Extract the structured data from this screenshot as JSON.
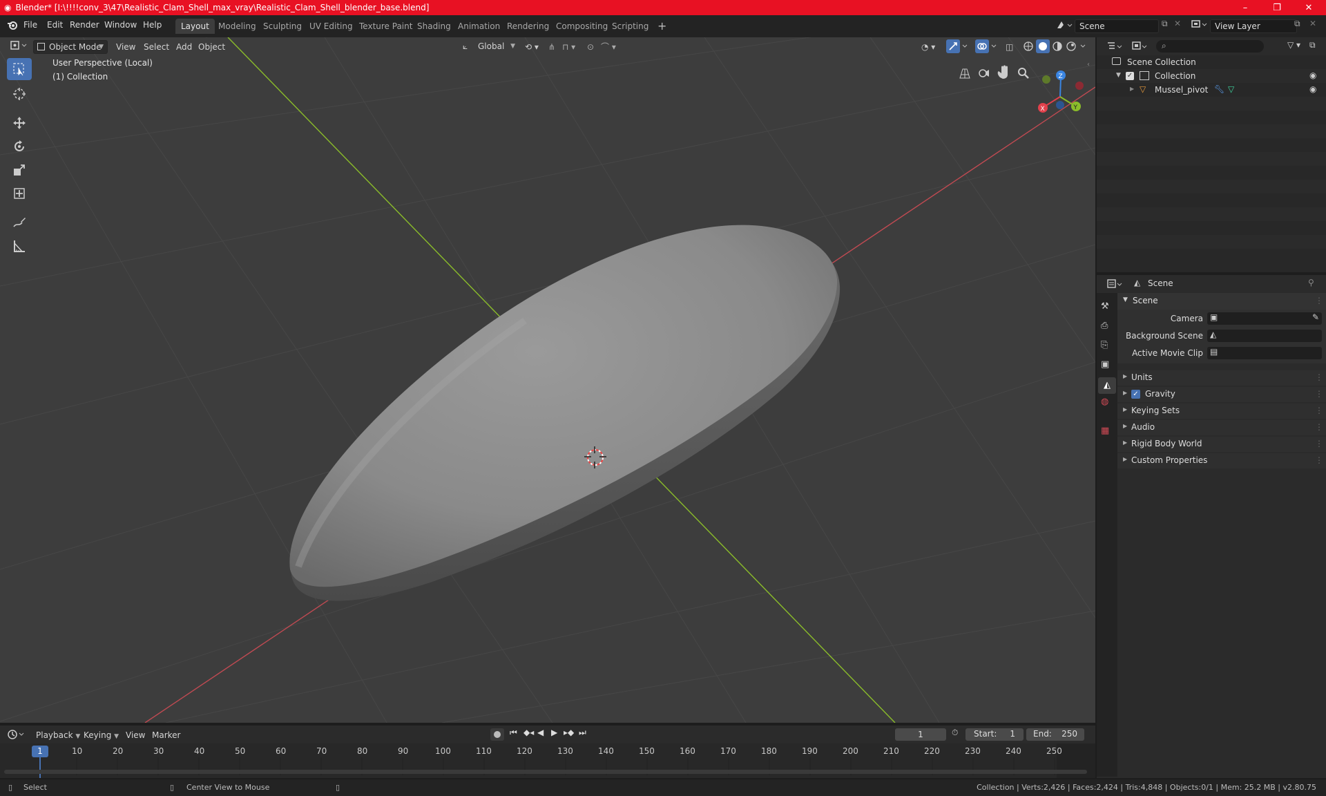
{
  "window": {
    "title": "Blender* [I:\\!!!!conv_3\\47\\Realistic_Clam_Shell_max_vray\\Realistic_Clam_Shell_blender_base.blend]",
    "minimize": "–",
    "maximize": "❐",
    "close": "✕"
  },
  "menu": {
    "file": "File",
    "edit": "Edit",
    "render": "Render",
    "window": "Window",
    "help": "Help"
  },
  "workspaces": [
    "Layout",
    "Modeling",
    "Sculpting",
    "UV Editing",
    "Texture Paint",
    "Shading",
    "Animation",
    "Rendering",
    "Compositing",
    "Scripting"
  ],
  "active_workspace": "Layout",
  "topright": {
    "scene": "Scene",
    "view_layer": "View Layer"
  },
  "viewport": {
    "mode": "Object Mode",
    "view": "View",
    "select": "Select",
    "add": "Add",
    "object": "Object",
    "transform_orientation": "Global",
    "overlay_line1": "User Perspective (Local)",
    "overlay_line2": "(1) Collection",
    "gizmo": {
      "x": "X",
      "y": "Y",
      "z": "Z"
    }
  },
  "outliner": {
    "root": "Scene Collection",
    "collection": "Collection",
    "object": "Mussel_pivot"
  },
  "properties": {
    "context": "Scene",
    "panel_title": "Scene",
    "camera_label": "Camera",
    "bg_scene_label": "Background Scene",
    "movie_clip_label": "Active Movie Clip",
    "sections": [
      "Units",
      "Gravity",
      "Keying Sets",
      "Audio",
      "Rigid Body World",
      "Custom Properties"
    ],
    "gravity_checked": true
  },
  "timeline": {
    "playback": "Playback",
    "keying": "Keying",
    "view": "View",
    "marker": "Marker",
    "current_frame": "1",
    "start_label": "Start:",
    "start_value": "1",
    "end_label": "End:",
    "end_value": "250",
    "ticks": [
      "10",
      "20",
      "30",
      "40",
      "50",
      "60",
      "70",
      "80",
      "90",
      "100",
      "110",
      "120",
      "130",
      "140",
      "150",
      "160",
      "170",
      "180",
      "190",
      "200",
      "210",
      "220",
      "230",
      "240",
      "250"
    ],
    "playhead_label": "1"
  },
  "statusbar": {
    "select": "Select",
    "center_view": "Center View to Mouse",
    "stats": "Collection | Verts:2,426 | Faces:2,424 | Tris:4,848 | Objects:0/1 | Mem: 25.2 MB | v2.80.75"
  },
  "colors": {
    "titlebar": "#e81123",
    "accent": "#4772b3",
    "x_axis": "#e2414c",
    "y_axis": "#8bbd2a",
    "z_axis": "#3a85e2"
  }
}
